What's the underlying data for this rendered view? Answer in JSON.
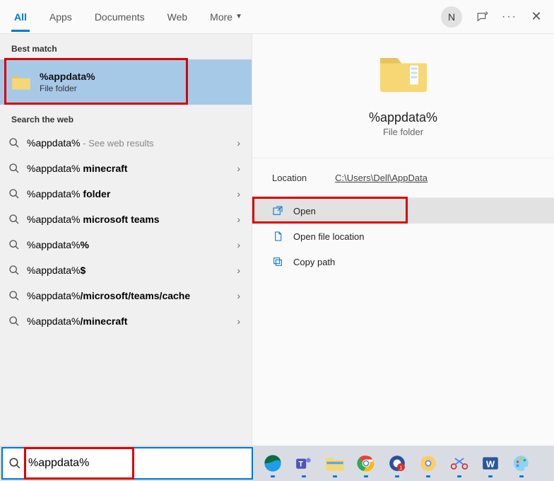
{
  "tabs": {
    "all": "All",
    "apps": "Apps",
    "documents": "Documents",
    "web": "Web",
    "more": "More"
  },
  "avatar_initial": "N",
  "labels": {
    "best": "Best match",
    "web": "Search the web"
  },
  "best_match": {
    "title": "%appdata%",
    "sub": "File folder"
  },
  "web_rows": [
    {
      "prefix": "%appdata%",
      "bold": "",
      "hint": " - See web results"
    },
    {
      "prefix": "%appdata%",
      "bold": " minecraft",
      "hint": ""
    },
    {
      "prefix": "%appdata%",
      "bold": " folder",
      "hint": ""
    },
    {
      "prefix": "%appdata%",
      "bold": " microsoft teams",
      "hint": ""
    },
    {
      "prefix": "%appdata%",
      "bold": "%",
      "hint": ""
    },
    {
      "prefix": "%appdata%",
      "bold": "$",
      "hint": ""
    },
    {
      "prefix": "%appdata%",
      "bold": "/microsoft/teams/cache",
      "hint": ""
    },
    {
      "prefix": "%appdata%",
      "bold": "/minecraft",
      "hint": ""
    }
  ],
  "detail": {
    "title": "%appdata%",
    "sub": "File folder",
    "location_label": "Location",
    "location_path": "C:\\Users\\Dell\\AppData"
  },
  "actions": {
    "open": "Open",
    "open_loc": "Open file location",
    "copy_path": "Copy path"
  },
  "search_value": "%appdata%"
}
